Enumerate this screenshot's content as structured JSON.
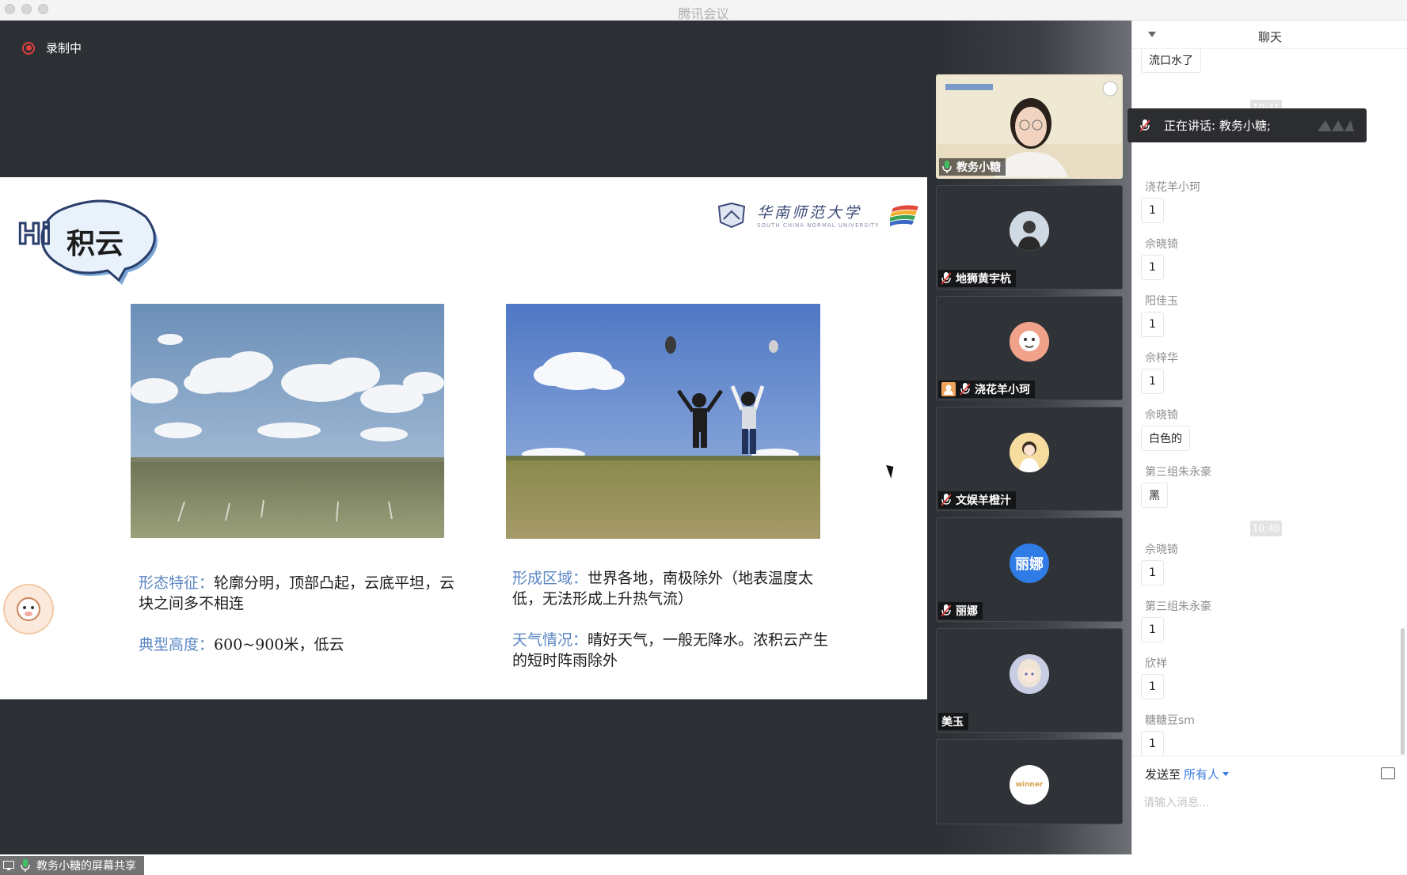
{
  "window": {
    "title": "腾讯会议"
  },
  "recording": {
    "label": "录制中"
  },
  "slide": {
    "hi_text": "Hi",
    "title": "积云",
    "school_name": "华南师范大学",
    "school_name_en": "SOUTH CHINA NORMAL UNIVERSITY",
    "d1_key": "形态特征：",
    "d1_val": "轮廓分明，顶部凸起，云底平坦，云块之间多不相连",
    "d2_key": "典型高度：",
    "d2_val": "600~900米，低云",
    "d3_key": "形成区域：",
    "d3_val": "世界各地，南极除外（地表温度太低，无法形成上升热气流）",
    "d4_key": "天气情况：",
    "d4_val": "晴好天气，一般无降水。浓积云产生的短时阵雨除外"
  },
  "share_label": "教务小糖的屏幕共享",
  "participants": [
    {
      "name": "教务小糖",
      "mic": "on"
    },
    {
      "name": "地狮黄宇杭",
      "mic": "muted"
    },
    {
      "name": "浇花羊小珂",
      "mic": "muted"
    },
    {
      "name": "文娱羊橙汁",
      "mic": "muted"
    },
    {
      "name": "丽娜",
      "mic": "muted",
      "avatar_text": "丽娜"
    },
    {
      "name": "美玉",
      "mic": "none"
    },
    {
      "name": "",
      "mic": "none",
      "avatar_text": "winner"
    }
  ],
  "chat": {
    "title": "聊天",
    "speaking": "正在讲话: 教务小糖;",
    "messages": {
      "m0_text": "流口水了",
      "t1": "10:31",
      "m1_sender": "欣祥",
      "m2_sender": "浇花羊小珂",
      "m2_text": "1",
      "m3_sender": "佘晓锜",
      "m3_text": "1",
      "m4_sender": "阳佳玉",
      "m4_text": "1",
      "m5_sender": "佘梓华",
      "m5_text": "1",
      "m6_sender": "佘晓锜",
      "m6_text": "白色的",
      "m7_sender": "第三组朱永豪",
      "m7_text": "黑",
      "t2": "10:40",
      "m8_sender": "佘晓锜",
      "m8_text": "1",
      "m9_sender": "第三组朱永豪",
      "m9_text": "1",
      "m10_sender": "欣祥",
      "m10_text": "1",
      "m11_sender": "糖糖豆sm",
      "m11_text": "1"
    },
    "send_to_label": "发送至",
    "send_target": "所有人",
    "input_placeholder": "请输入消息..."
  },
  "colors": {
    "accent": "#3a7be4",
    "record": "#e0403a",
    "stage_bg": "#2c2f34",
    "slide_key": "#5a86c4"
  }
}
